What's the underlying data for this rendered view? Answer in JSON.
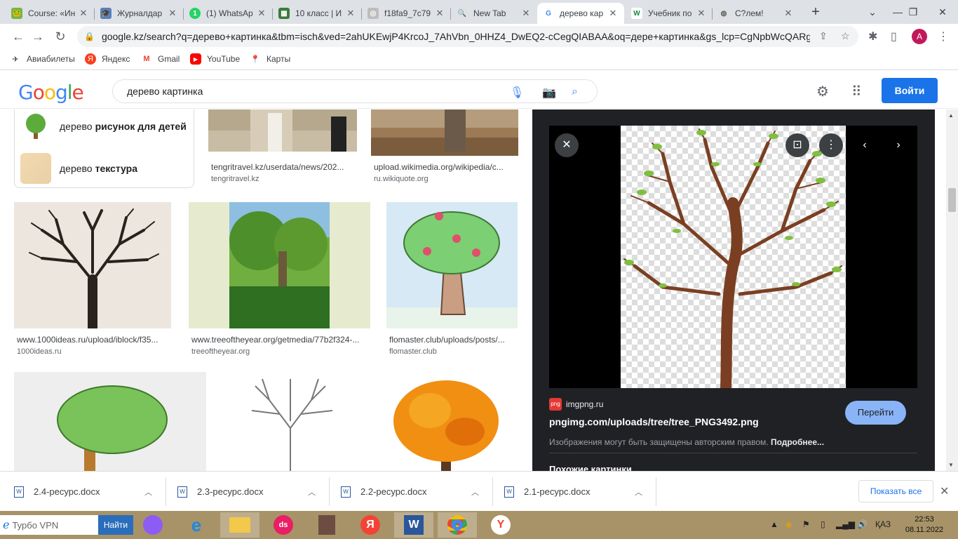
{
  "tabs": [
    {
      "title": "Course: «Ин",
      "color": "#7cb342",
      "glyph": "🐸"
    },
    {
      "title": "Журналдар",
      "color": "#5b7fb8",
      "glyph": "🎓"
    },
    {
      "title": "(1) WhatsAp",
      "color": "#25d366",
      "glyph": "1"
    },
    {
      "title": "10 класс | И",
      "color": "#3b7b3b",
      "glyph": "▦"
    },
    {
      "title": "f18fa9_7c79",
      "color": "#bdbdbd",
      "glyph": "◎"
    },
    {
      "title": "New Tab",
      "color": "#9e9e9e",
      "glyph": "🔍"
    },
    {
      "title": "дерево кар",
      "color": "#ffffff",
      "glyph": "G"
    },
    {
      "title": "Учебник по",
      "color": "#1b8a3a",
      "glyph": "W"
    },
    {
      "title": "C?лем!",
      "color": "#9e9e9e",
      "glyph": "🌐"
    }
  ],
  "address": {
    "url": "google.kz/search?q=дерево+картинка&tbm=isch&ved=2ahUKEwjP4KrcoJ_7AhVbn_0HHZ4_DwEQ2-cCegQIABAA&oq=дере+картинка&gs_lcp=CgNpbWcQARg..."
  },
  "profile": {
    "initial": "A"
  },
  "bookmarks": [
    {
      "label": "Авиабилеты",
      "icon": "plane-icon"
    },
    {
      "label": "Яндекс",
      "icon": "yandex-icon"
    },
    {
      "label": "Gmail",
      "icon": "gmail-icon"
    },
    {
      "label": "YouTube",
      "icon": "youtube-icon"
    },
    {
      "label": "Карты",
      "icon": "maps-icon"
    }
  ],
  "google": {
    "logo": [
      "G",
      "o",
      "o",
      "g",
      "l",
      "e"
    ],
    "query": "дерево картинка",
    "login": "Войти"
  },
  "suggestions": [
    {
      "prefix": "дерево",
      "bold": "рисунок для детей"
    },
    {
      "prefix": "дерево",
      "bold": "текстура"
    }
  ],
  "results": [
    {
      "source": "tengritravel.kz/userdata/news/202...",
      "domain": "tengritravel.kz"
    },
    {
      "source": "upload.wikimedia.org/wikipedia/c...",
      "domain": "ru.wikiquote.org"
    },
    {
      "source": "www.1000ideas.ru/upload/iblock/f35...",
      "domain": "1000ideas.ru"
    },
    {
      "source": "www.treeoftheyear.org/getmedia/77b2f324-...",
      "domain": "treeoftheyear.org"
    },
    {
      "source": "flomaster.club/uploads/posts/...",
      "domain": "flomaster.club"
    }
  ],
  "viewer": {
    "site": "imgpng.ru",
    "site_badge": "png",
    "title": "pngimg.com/uploads/tree/tree_PNG3492.png",
    "copyright": "Изображения могут быть защищены авторским правом.",
    "more": "Подробнее...",
    "go": "Перейти",
    "similar": "Похожие картинки"
  },
  "downloads": [
    {
      "name": "2.4-ресурс.docx"
    },
    {
      "name": "2.3-ресурс.docx"
    },
    {
      "name": "2.2-ресурс.docx"
    },
    {
      "name": "2.1-ресурс.docx"
    }
  ],
  "downloads_show_all": "Показать все",
  "taskbar": {
    "search_label": "Турбо VPN",
    "find_button": "Найти",
    "lang": "ҚАЗ",
    "time": "22:53",
    "date": "08.11.2022"
  }
}
